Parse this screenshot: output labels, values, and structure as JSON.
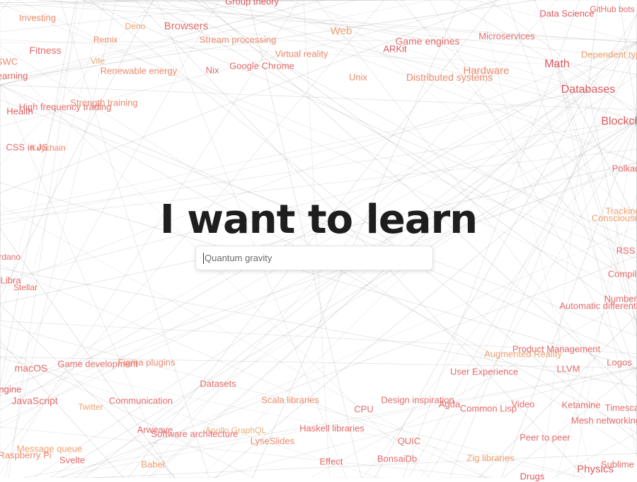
{
  "hero": {
    "title": "I want to learn"
  },
  "search": {
    "placeholder": "Quantum gravity",
    "value": ""
  },
  "colors": {
    "line": "#9a9a9a",
    "title": "#1e1e1e",
    "accent_red": "#dd5a5f",
    "accent_orange": "#f0a070"
  },
  "topics": [
    "Investing",
    "Deno",
    "Browsers",
    "Stream processing",
    "Web",
    "Game engines",
    "Microservices",
    "Data Science",
    "GitHub bots",
    "Fitness",
    "Remix",
    "Virtual reality",
    "ARKit",
    "Dependent types",
    "Vite",
    "Renewable energy",
    "Nix",
    "Google Chrome",
    "Unix",
    "Distributed systems",
    "Hardware",
    "Math",
    "Learning",
    "Databases",
    "Strength training",
    "High frequency trading",
    "Health",
    "CSS in JS",
    "Keychain",
    "Polkadot",
    "Tracking",
    "Consciousness",
    "Cardano",
    "RSS",
    "Libra",
    "Stellar",
    "Automatic differentiation",
    "Numbers",
    "Product Management",
    "Augmented Reality",
    "macOS",
    "Game development",
    "Figma plugins",
    "User Experience",
    "LLVM",
    "Logos",
    "Datasets",
    "JavaScript",
    "Twitter",
    "Communication",
    "Scala libraries",
    "CPU",
    "Design inspiration",
    "Agda",
    "Common Lisp",
    "Video",
    "Ketamine",
    "Mesh networking",
    "Timescale",
    "Arweave",
    "Apollo GraphQL",
    "Software architecture",
    "Haskell libraries",
    "Peer to peer",
    "Message queue",
    "Raspberry Pi",
    "LyseSlides",
    "QUIC",
    "Svelte",
    "Babel",
    "Effect",
    "BonsaiDb",
    "Zig libraries",
    "Physics",
    "Sublime Text",
    "Drugs",
    "Group theory",
    "Engine",
    "Blockchain",
    "Compilers",
    "SWC"
  ]
}
